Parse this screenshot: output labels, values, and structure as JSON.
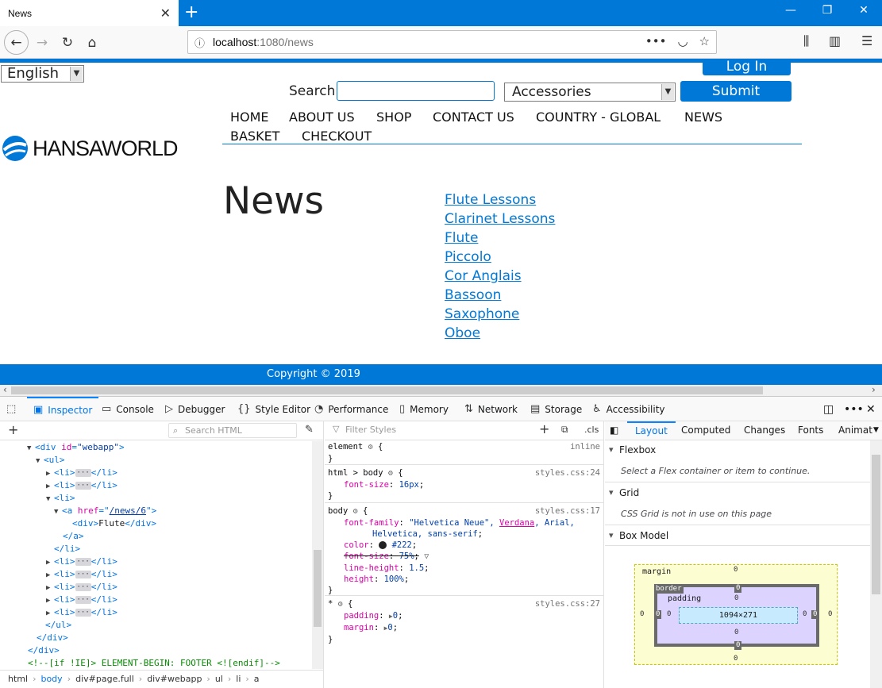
{
  "browser": {
    "tab_title": "News",
    "new_tab_icon": "plus",
    "url_host": "localhost",
    "url_path": ":1080/news"
  },
  "site": {
    "language": "English",
    "login_label": "Log In",
    "search_label": "Search",
    "search_value": "",
    "category": "Accessories",
    "submit_label": "Submit",
    "logo_text": "HANSAWORLD",
    "nav": [
      {
        "label": "HOME"
      },
      {
        "label": "ABOUT US"
      },
      {
        "label": "SHOP"
      },
      {
        "label": "CONTACT US"
      },
      {
        "label": "COUNTRY - GLOBAL"
      },
      {
        "label": "NEWS"
      },
      {
        "label": "BASKET"
      },
      {
        "label": "CHECKOUT"
      }
    ],
    "page_heading": "News",
    "news_links": [
      "Flute Lessons",
      "Clarinet Lessons",
      "Flute",
      "Piccolo",
      "Cor Anglais",
      "Bassoon",
      "Saxophone",
      "Oboe"
    ],
    "copyright": "Copyright © 2019",
    "brand_color": "#0078d7"
  },
  "devtools": {
    "tabs": [
      {
        "label": "Inspector",
        "icon": "inspector-icon"
      },
      {
        "label": "Console",
        "icon": "console-icon"
      },
      {
        "label": "Debugger",
        "icon": "debugger-icon"
      },
      {
        "label": "Style Editor",
        "icon": "style-editor-icon"
      },
      {
        "label": "Performance",
        "icon": "performance-icon"
      },
      {
        "label": "Memory",
        "icon": "memory-icon"
      },
      {
        "label": "Network",
        "icon": "network-icon"
      },
      {
        "label": "Storage",
        "icon": "storage-icon"
      },
      {
        "label": "Accessibility",
        "icon": "accessibility-icon"
      }
    ],
    "search_html_placeholder": "Search HTML",
    "filter_styles_placeholder": "Filter Styles",
    "cls_label": ".cls",
    "tree": {
      "r1_tag": "<div ",
      "r1_attr": "id",
      "r1_val": "\"webapp\"",
      "r1_end": ">",
      "r2": "<ul>",
      "li_open": "<li>",
      "li_close": "</li>",
      "a_open": "<a ",
      "a_attr": "href",
      "a_val": "/news/6",
      "a_end": ">",
      "div_open": "<div>",
      "div_text": "Flute",
      "div_close": "</div>",
      "a_close": "</a>",
      "ul_close": "</ul>",
      "comment": "<!--[if !IE]> ELEMENT-BEGIN: FOOTER <![endif]-->"
    },
    "breadcrumb": [
      "html",
      "body",
      "div#page.full",
      "div#webapp",
      "ul",
      "li",
      "a"
    ],
    "css": {
      "r1_sel": "element",
      "r1_src": "inline",
      "r2_sel": "html > body",
      "r2_src": "styles.css:24",
      "r2_p1": "font-size",
      "r2_v1": "16px",
      "r3_sel": "body",
      "r3_src": "styles.css:17",
      "r3_p1": "font-family",
      "r3_v1a": "\"Helvetica Neue\", ",
      "r3_v1b": "Verdana",
      "r3_v1c": ", Arial,",
      "r3_v1d": "Helvetica, sans-serif",
      "r3_p2": "color",
      "r3_v2": "#222",
      "r3_p3": "font-size",
      "r3_v3": "75%",
      "r3_p4": "line-height",
      "r3_v4": "1.5",
      "r3_p5": "height",
      "r3_v5": "100%",
      "r4_sel": "*",
      "r4_src": "styles.css:27",
      "r4_p1": "padding",
      "r4_v1": "0",
      "r4_p2": "margin",
      "r4_v2": "0"
    },
    "layout_tabs": [
      "Layout",
      "Computed",
      "Changes",
      "Fonts",
      "Animat"
    ],
    "flexbox_title": "Flexbox",
    "flexbox_note": "Select a Flex container or item to continue.",
    "grid_title": "Grid",
    "grid_note": "CSS Grid is not in use on this page",
    "boxmodel_title": "Box Model",
    "boxmodel": {
      "margin_label": "margin",
      "border_label": "border",
      "padding_label": "padding",
      "content_size": "1094×271",
      "zero": "0"
    }
  }
}
